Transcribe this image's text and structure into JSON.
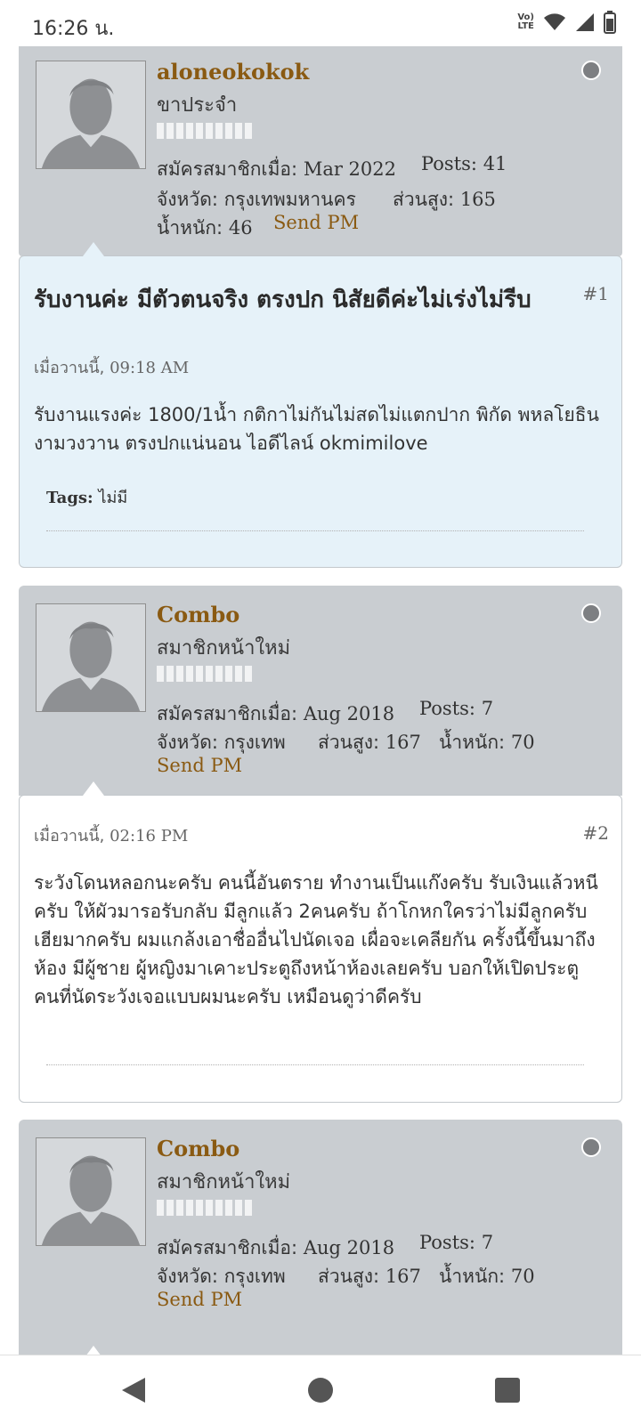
{
  "status_bar": {
    "time": "16:26 น.",
    "icons": [
      "volte-icon",
      "wifi-icon",
      "signal-icon",
      "battery-icon"
    ],
    "volte_label": "Vo LTE"
  },
  "colors": {
    "username": "#8a5a12",
    "userinfo_bg": "#c9cdd1",
    "post1_bg": "#e6f2f9",
    "post_bg": "#ffffff"
  },
  "posts": [
    {
      "username": "aloneokokok",
      "user_title": "ขาประจำ",
      "joined_label": "สมัครสมาชิกเมื่อ:",
      "joined_value": "Mar 2022",
      "posts_label": "Posts:",
      "posts_value": "41",
      "province_label": "จังหวัด:",
      "province_value": "กรุงเทพมหานคร",
      "height_label": "ส่วนสูง:",
      "height_value": "165",
      "weight_label": "น้ำหนัก:",
      "weight_value": "46",
      "send_pm": "Send PM",
      "title": "รับงานค่ะ มีตัวตนจริง ตรงปก นิสัยดีค่ะไม่เร่งไม่รีบ",
      "number": "#1",
      "date_prefix": "เมื่อวานนี้,",
      "date_time": "09:18 AM",
      "text": "รับงานแรงค่ะ 1800/1น้ำ กติกาไม่กันไม่สดไม่แตกปาก พิกัด พหลโยธิน งามวงวาน ตรงปกแน่นอน ไอดีไลน์ okmimilove",
      "tags_label": "Tags:",
      "tags_value": "ไม่มี"
    },
    {
      "username": "Combo",
      "user_title": "สมาชิกหน้าใหม่",
      "joined_label": "สมัครสมาชิกเมื่อ:",
      "joined_value": "Aug 2018",
      "posts_label": "Posts:",
      "posts_value": "7",
      "province_label": "จังหวัด:",
      "province_value": "กรุงเทพ",
      "height_label": "ส่วนสูง:",
      "height_value": "167",
      "weight_label": "น้ำหนัก:",
      "weight_value": "70",
      "send_pm": "Send PM",
      "number": "#2",
      "date_prefix": "เมื่อวานนี้,",
      "date_time": "02:16 PM",
      "text": "ระวังโดนหลอกนะครับ คนนี้อันตราย ทำงานเป็นแก๊งครับ รับเงินแล้วหนีครับ ให้ผัวมารอรับกลับ มีลูกแล้ว 2คนครับ ถ้าโกหกใครว่าไม่มีลูกครับ เฮียมากครับ ผมแกล้งเอาชื่ออื่นไปนัดเจอ เผื่อจะเคลียกัน ครั้งนี้ขึ้นมาถึงห้อง มีผู้ชาย ผู้หญิงมาเคาะประตูถึงหน้าห้องเลยครับ บอกให้เปิดประตู คนที่นัดระวังเจอแบบผมนะครับ เหมือนดูว่าดีครับ"
    },
    {
      "username": "Combo",
      "user_title": "สมาชิกหน้าใหม่",
      "joined_label": "สมัครสมาชิกเมื่อ:",
      "joined_value": "Aug 2018",
      "posts_label": "Posts:",
      "posts_value": "7",
      "province_label": "จังหวัด:",
      "province_value": "กรุงเทพ",
      "height_label": "ส่วนสูง:",
      "height_value": "167",
      "weight_label": "น้ำหนัก:",
      "weight_value": "70",
      "send_pm": "Send PM"
    }
  ],
  "nav_bar": {
    "icons": [
      "back-icon",
      "home-icon",
      "recents-icon"
    ]
  }
}
